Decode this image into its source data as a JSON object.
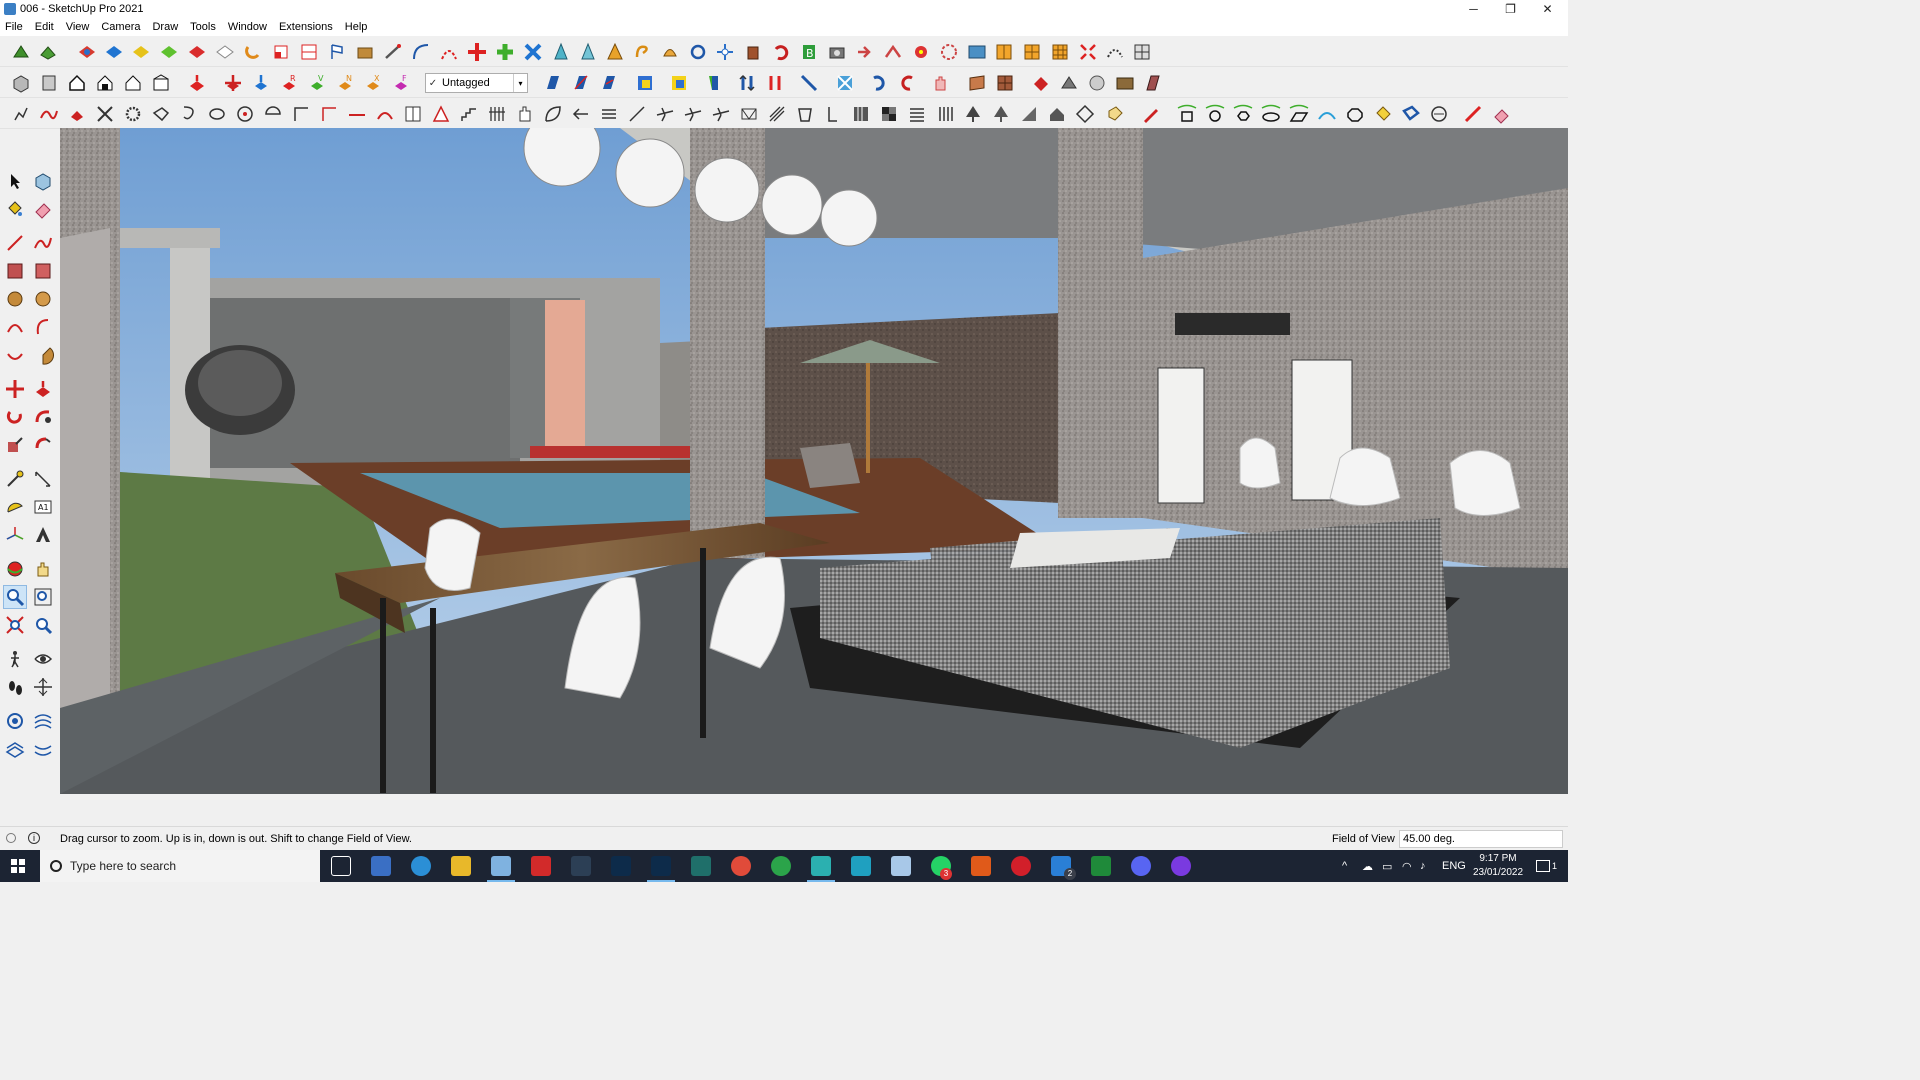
{
  "window": {
    "title": "006 - SketchUp Pro 2021",
    "controls": {
      "minimize": "─",
      "maximize": "❐",
      "close": "✕"
    }
  },
  "menu": [
    "File",
    "Edit",
    "View",
    "Camera",
    "Draw",
    "Tools",
    "Window",
    "Extensions",
    "Help"
  ],
  "tags_toolbar": {
    "check": "✓",
    "selected_tag": "Untagged",
    "arrow": "▾"
  },
  "status": {
    "message": "Drag cursor to zoom.  Up is in, down is out. Shift to change Field of View.",
    "measurement_label": "Field of View",
    "measurement_value": "45.00 deg."
  },
  "taskbar": {
    "search_placeholder": "Type here to search",
    "language": "ENG",
    "time": "9:17 PM",
    "date": "23/01/2022",
    "notification_count": "1",
    "badges": {
      "whatsapp": "3",
      "vscode": "2"
    }
  },
  "colors": {
    "accent": "#76b9ed",
    "taskbar": "#1c2433",
    "sky": "#8fb5dd",
    "floor": "#55595c",
    "pool": "#5c95ad",
    "wall": "#8f8f8f"
  }
}
